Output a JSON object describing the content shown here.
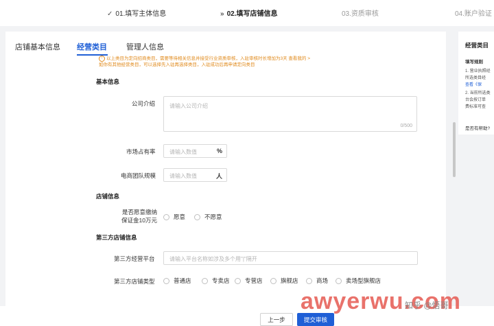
{
  "stepper": {
    "steps": [
      {
        "mark": "✓",
        "label": "01.填写主体信息"
      },
      {
        "mark": "»",
        "label": "02.填写店铺信息"
      },
      {
        "mark": "",
        "label": "03.资质审核"
      },
      {
        "mark": "",
        "label": "04.账户验证"
      }
    ]
  },
  "tabs": [
    "店铺基本信息",
    "经营类目",
    "管理人信息"
  ],
  "notice": {
    "line1": "以上类目为定向招商类目，需要等待相关信息并接受行业资质审核，入驻审核时长增加为3天 查看我的 >",
    "line2": "如你有其他经营类目，可以选择先入驻再选择类目，入驻成功后再申请定向类目"
  },
  "basic": {
    "title": "基本信息",
    "company_intro_label": "公司介绍",
    "company_intro_placeholder": "请输入公司介绍",
    "company_intro_count": "0/500",
    "market_share_label": "市场占有率",
    "market_share_placeholder": "请输入数值",
    "market_share_suffix": "%",
    "team_size_label": "电商团队规模",
    "team_size_placeholder": "请输入数值",
    "team_size_suffix": "人"
  },
  "store": {
    "title": "店铺信息",
    "deposit_label_line1": "是否愿意缴纳",
    "deposit_label_line2": "保证金10万元",
    "deposit_yes": "愿意",
    "deposit_no": "不愿意"
  },
  "third_party": {
    "title": "第三方店铺信息",
    "platform_label": "第三方经营平台",
    "platform_placeholder": "请输入平台名称如涉及多个用\"|\"隔开",
    "store_type_label": "第三方店铺类型",
    "store_types": [
      "普通店",
      "专卖店",
      "专营店",
      "旗舰店",
      "商场",
      "卖场型旗舰店"
    ]
  },
  "side": {
    "title": "经营类目",
    "subtitle": "填写规则",
    "lines": [
      "1. 营业执照经",
      "所选类目经",
      "查看《保",
      "2. 当前所选类",
      "台会按订单",
      "费标准可查"
    ],
    "help": "是否有帮助?"
  },
  "footer": {
    "prev": "上一步",
    "submit": "提交审核"
  },
  "watermark": {
    "text": "awyerwu.com",
    "sub": "知乎 @悟哥"
  }
}
